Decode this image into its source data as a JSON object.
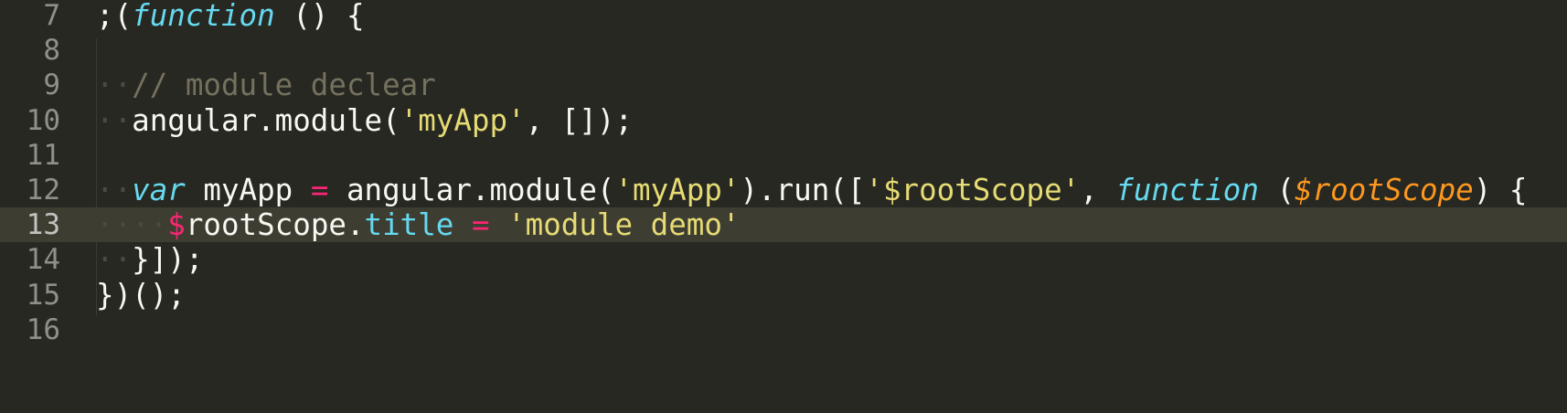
{
  "editor": {
    "lines": [
      {
        "number": "7",
        "tokens": [
          {
            "t": ";(",
            "c": "pl"
          },
          {
            "t": "function",
            "c": "kw"
          },
          {
            "t": " () {",
            "c": "pl"
          }
        ]
      },
      {
        "number": "8",
        "tokens": []
      },
      {
        "number": "9",
        "tokens": [
          {
            "t": "··",
            "c": "ws"
          },
          {
            "t": "// module declear",
            "c": "cm"
          }
        ]
      },
      {
        "number": "10",
        "tokens": [
          {
            "t": "··",
            "c": "ws"
          },
          {
            "t": "angular.module(",
            "c": "pl"
          },
          {
            "t": "'myApp'",
            "c": "str"
          },
          {
            "t": ", []);",
            "c": "pl"
          }
        ]
      },
      {
        "number": "11",
        "tokens": []
      },
      {
        "number": "12",
        "tokens": [
          {
            "t": "··",
            "c": "ws"
          },
          {
            "t": "var",
            "c": "kw"
          },
          {
            "t": " myApp ",
            "c": "pl"
          },
          {
            "t": "=",
            "c": "op"
          },
          {
            "t": " angular.module(",
            "c": "pl"
          },
          {
            "t": "'myApp'",
            "c": "str"
          },
          {
            "t": ").run([",
            "c": "pl"
          },
          {
            "t": "'$rootScope'",
            "c": "str"
          },
          {
            "t": ", ",
            "c": "pl"
          },
          {
            "t": "function",
            "c": "kw"
          },
          {
            "t": " (",
            "c": "pl"
          },
          {
            "t": "$rootScope",
            "c": "param"
          },
          {
            "t": ") {",
            "c": "pl"
          }
        ]
      },
      {
        "number": "13",
        "current": true,
        "tokens": [
          {
            "t": "····",
            "c": "ws"
          },
          {
            "t": "$",
            "c": "op"
          },
          {
            "t": "rootScope.",
            "c": "pl"
          },
          {
            "t": "title",
            "c": "prop"
          },
          {
            "t": " ",
            "c": "pl"
          },
          {
            "t": "=",
            "c": "op"
          },
          {
            "t": " ",
            "c": "pl"
          },
          {
            "t": "'module demo'",
            "c": "str"
          }
        ]
      },
      {
        "number": "14",
        "tokens": [
          {
            "t": "··",
            "c": "ws"
          },
          {
            "t": "}]);",
            "c": "pl"
          }
        ]
      },
      {
        "number": "15",
        "tokens": [
          {
            "t": "})();",
            "c": "pl"
          }
        ]
      },
      {
        "number": "16",
        "tokens": []
      }
    ]
  },
  "colors": {
    "background": "#272822",
    "current_line": "#3e3d32",
    "keyword": "#66d9ef",
    "comment": "#75715e",
    "string": "#e6db74",
    "operator": "#f92672",
    "parameter": "#fd971f",
    "plain": "#f8f8f2"
  }
}
